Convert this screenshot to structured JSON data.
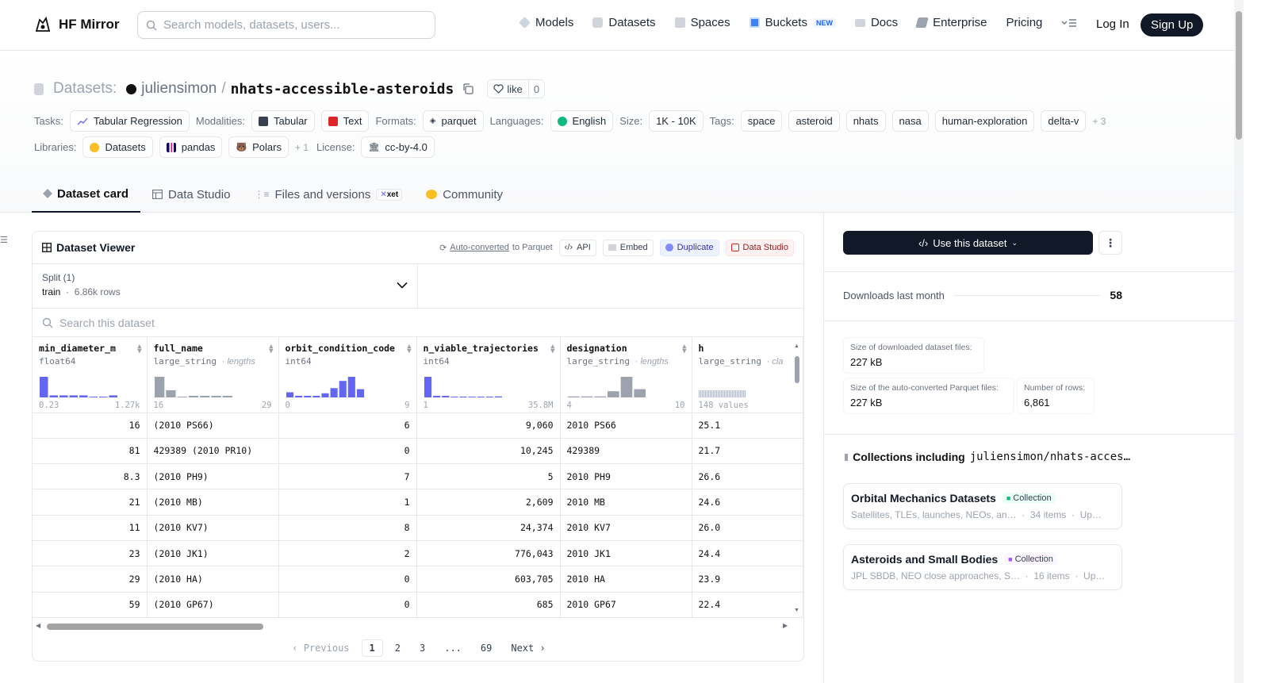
{
  "nav": {
    "brand": "HF Mirror",
    "search_placeholder": "Search models, datasets, users...",
    "links": [
      "Models",
      "Datasets",
      "Spaces",
      "Buckets",
      "Docs",
      "Enterprise",
      "Pricing"
    ],
    "new_badge": "NEW",
    "login": "Log In",
    "signup": "Sign Up"
  },
  "header": {
    "type_label": "Datasets:",
    "user": "juliensimon",
    "sep": "/",
    "repo": "nhats-accessible-asteroids",
    "like_label": "like",
    "like_count": "0"
  },
  "meta": {
    "tasks_label": "Tasks:",
    "task": "Tabular Regression",
    "modalities_label": "Modalities:",
    "modalities": [
      "Tabular",
      "Text"
    ],
    "formats_label": "Formats:",
    "format": "parquet",
    "languages_label": "Languages:",
    "language": "English",
    "size_label": "Size:",
    "size": "1K - 10K",
    "tags_label": "Tags:",
    "tags": [
      "space",
      "asteroid",
      "nhats",
      "nasa",
      "human-exploration",
      "delta-v"
    ],
    "tags_more": "+ 3",
    "libraries_label": "Libraries:",
    "libraries": [
      "Datasets",
      "pandas",
      "Polars"
    ],
    "libraries_more": "+ 1",
    "license_label": "License:",
    "license": "cc-by-4.0"
  },
  "tabs": {
    "card": "Dataset card",
    "studio": "Data Studio",
    "files": "Files and versions",
    "xet": "xet",
    "community": "Community"
  },
  "viewer": {
    "title": "Dataset Viewer",
    "auto_link": "Auto-converted",
    "auto_rest": "to Parquet",
    "api": "API",
    "embed": "Embed",
    "duplicate": "Duplicate",
    "studio": "Data Studio",
    "split_label": "Split (1)",
    "split_name": "train",
    "split_rows": "6.86k rows",
    "search_placeholder": "Search this dataset",
    "columns": [
      {
        "name": "min_diameter_m",
        "type": "float64",
        "extra": "",
        "min": "0.23",
        "max": "1.27k"
      },
      {
        "name": "full_name",
        "type": "large_string",
        "extra": "lengths",
        "min": "16",
        "max": "29"
      },
      {
        "name": "orbit_condition_code",
        "type": "int64",
        "extra": "",
        "min": "0",
        "max": "9"
      },
      {
        "name": "n_viable_trajectories",
        "type": "int64",
        "extra": "",
        "min": "1",
        "max": "35.8M"
      },
      {
        "name": "designation",
        "type": "large_string",
        "extra": "lengths",
        "min": "4",
        "max": "10"
      },
      {
        "name": "h",
        "type": "large_string",
        "extra": "cla",
        "min": "148 values",
        "max": ""
      }
    ],
    "rows": [
      [
        "16",
        "(2010 PS66)",
        "6",
        "9,060",
        "2010 PS66",
        "25.1"
      ],
      [
        "81",
        "429389 (2010 PR10)",
        "0",
        "10,245",
        "429389",
        "21.7"
      ],
      [
        "8.3",
        "(2010 PH9)",
        "7",
        "5",
        "2010 PH9",
        "26.6"
      ],
      [
        "21",
        "(2010 MB)",
        "1",
        "2,609",
        "2010 MB",
        "24.6"
      ],
      [
        "11",
        "(2010 KV7)",
        "8",
        "24,374",
        "2010 KV7",
        "26.0"
      ],
      [
        "23",
        "(2010 JK1)",
        "2",
        "776,043",
        "2010 JK1",
        "24.4"
      ],
      [
        "29",
        "(2010 HA)",
        "0",
        "603,705",
        "2010 HA",
        "23.9"
      ],
      [
        "59",
        "(2010 GP67)",
        "0",
        "685",
        "2010 GP67",
        "22.4"
      ]
    ],
    "pager": {
      "prev": "Previous",
      "pages": [
        "1",
        "2",
        "3",
        "...",
        "69"
      ],
      "next": "Next"
    }
  },
  "sidebar": {
    "use_button": "Use this dataset",
    "downloads_label": "Downloads last month",
    "downloads_value": "58",
    "dl_size_label": "Size of downloaded dataset files:",
    "dl_size_value": "227 kB",
    "parquet_size_label": "Size of the auto-converted Parquet files:",
    "parquet_size_value": "227 kB",
    "rows_label": "Number of rows:",
    "rows_value": "6,861",
    "collections_label": "Collections including",
    "collections_repo": "juliensimon/nhats-acces…",
    "collections": [
      {
        "title": "Orbital Mechanics Datasets",
        "badge": "Collection",
        "desc": "Satellites, TLEs, launches, NEOs, an…",
        "items": "34 items",
        "updated": "Up…"
      },
      {
        "title": "Asteroids and Small Bodies",
        "badge": "Collection",
        "desc": "JPL SBDB, NEO close approaches, S…",
        "items": "16 items",
        "updated": "Up…"
      }
    ]
  },
  "colors": {
    "accent_bar": "#6366f1",
    "gray_bar": "#9ca3af",
    "dark": "#111827"
  }
}
